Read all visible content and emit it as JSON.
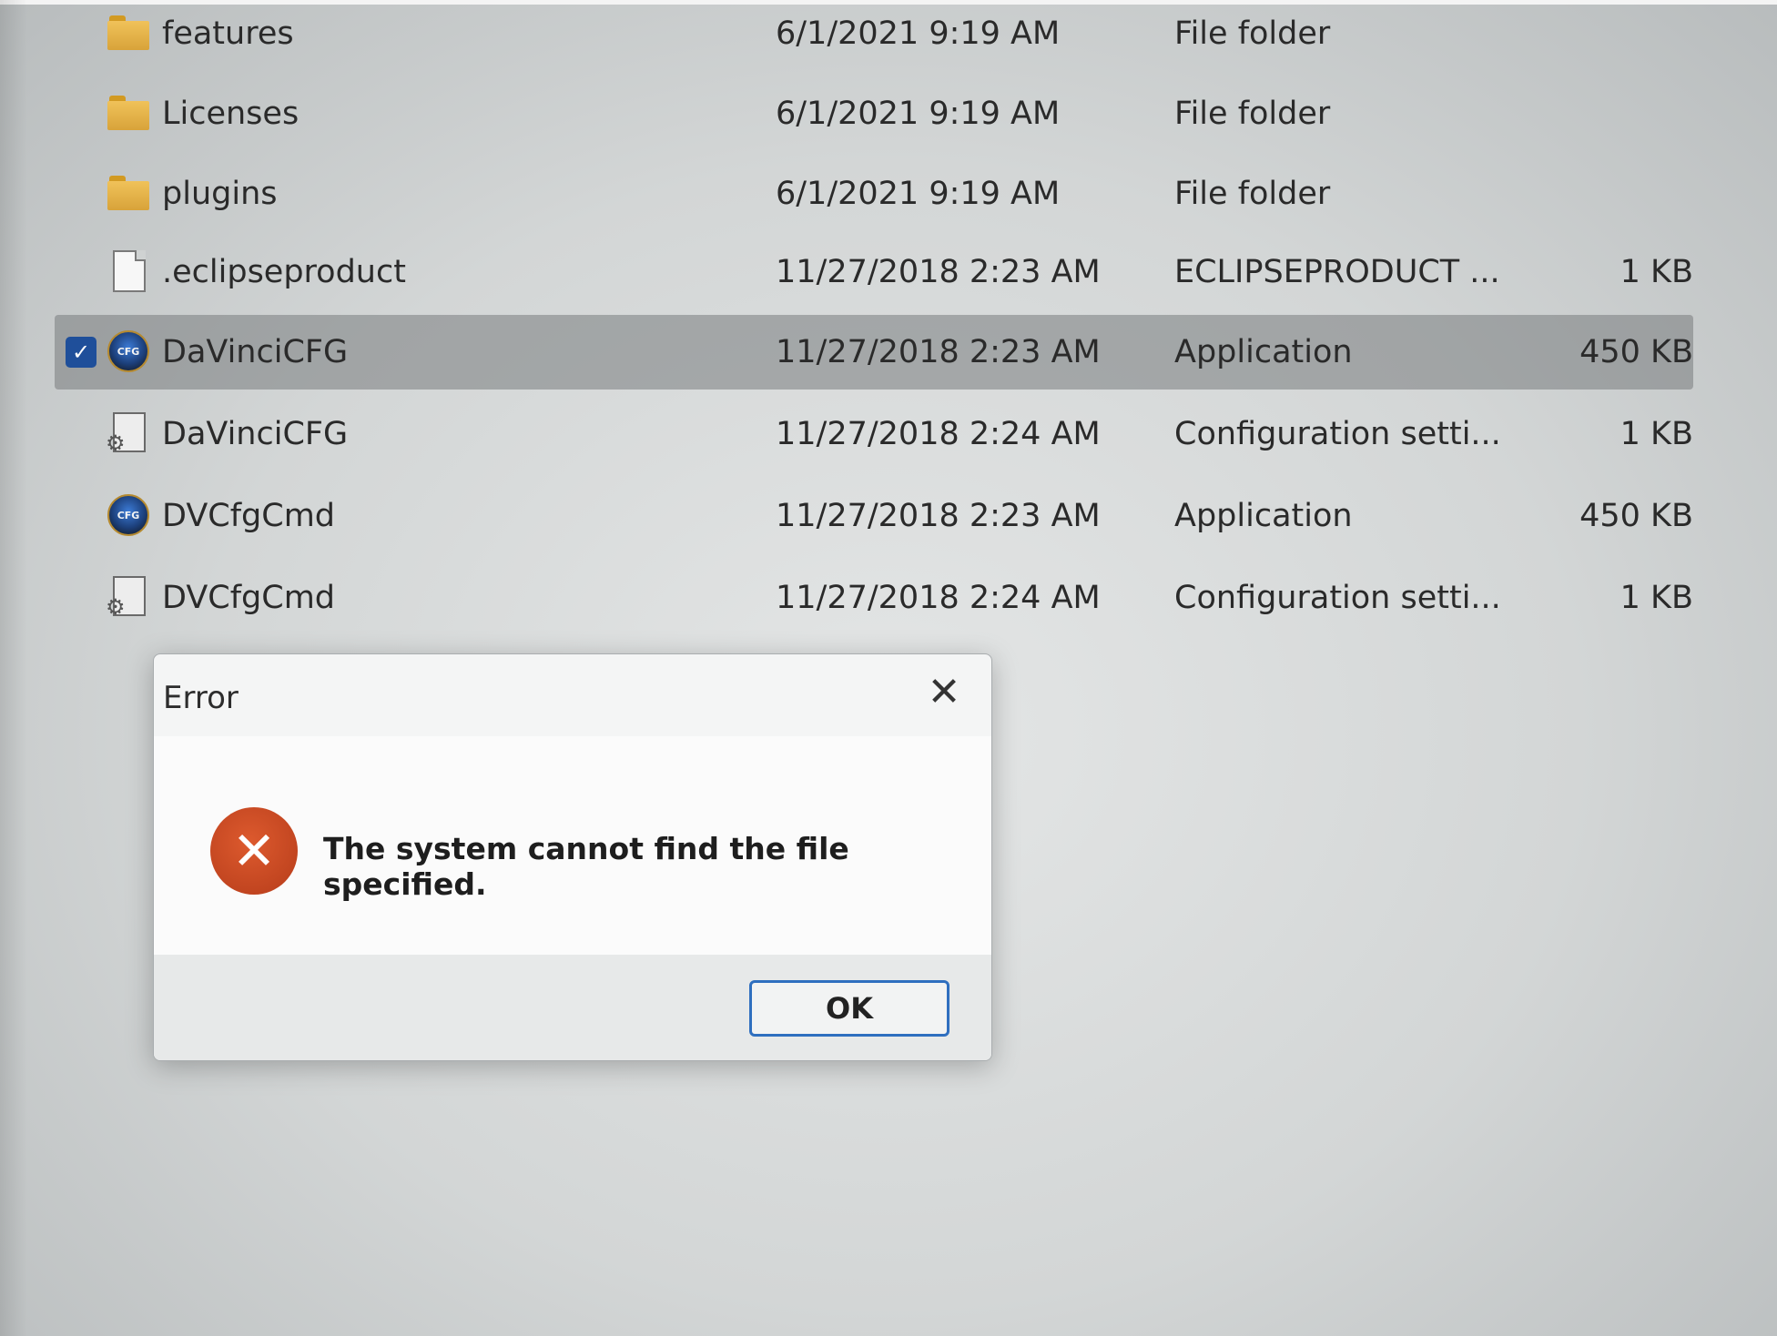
{
  "files": [
    {
      "name": "features",
      "date": "6/1/2021 9:19 AM",
      "type": "File folder",
      "size": "",
      "icon": "folder-icon",
      "selected": false
    },
    {
      "name": "Licenses",
      "date": "6/1/2021 9:19 AM",
      "type": "File folder",
      "size": "",
      "icon": "folder-icon",
      "selected": false
    },
    {
      "name": "plugins",
      "date": "6/1/2021 9:19 AM",
      "type": "File folder",
      "size": "",
      "icon": "folder-icon",
      "selected": false
    },
    {
      "name": ".eclipseproduct",
      "date": "11/27/2018 2:23 AM",
      "type": "ECLIPSEPRODUCT ...",
      "size": "1 KB",
      "icon": "file-icon",
      "selected": false
    },
    {
      "name": "DaVinciCFG",
      "date": "11/27/2018 2:23 AM",
      "type": "Application",
      "size": "450 KB",
      "icon": "app-icon",
      "selected": true
    },
    {
      "name": "DaVinciCFG",
      "date": "11/27/2018 2:24 AM",
      "type": "Configuration setti...",
      "size": "1 KB",
      "icon": "config-file-icon",
      "selected": false
    },
    {
      "name": "DVCfgCmd",
      "date": "11/27/2018 2:23 AM",
      "type": "Application",
      "size": "450 KB",
      "icon": "app-icon",
      "selected": false
    },
    {
      "name": "DVCfgCmd",
      "date": "11/27/2018 2:24 AM",
      "type": "Configuration setti...",
      "size": "1 KB",
      "icon": "config-file-icon",
      "selected": false
    }
  ],
  "app_icon_text": "CFG",
  "dialog": {
    "title": "Error",
    "close_glyph": "✕",
    "error_glyph": "✕",
    "message": "The system cannot find the file specified.",
    "ok_label": "OK"
  },
  "colors": {
    "selection": "#7c8082",
    "error_red": "#c5461f",
    "ok_border": "#2f6fbf",
    "checkbox": "#1f4f9a"
  }
}
